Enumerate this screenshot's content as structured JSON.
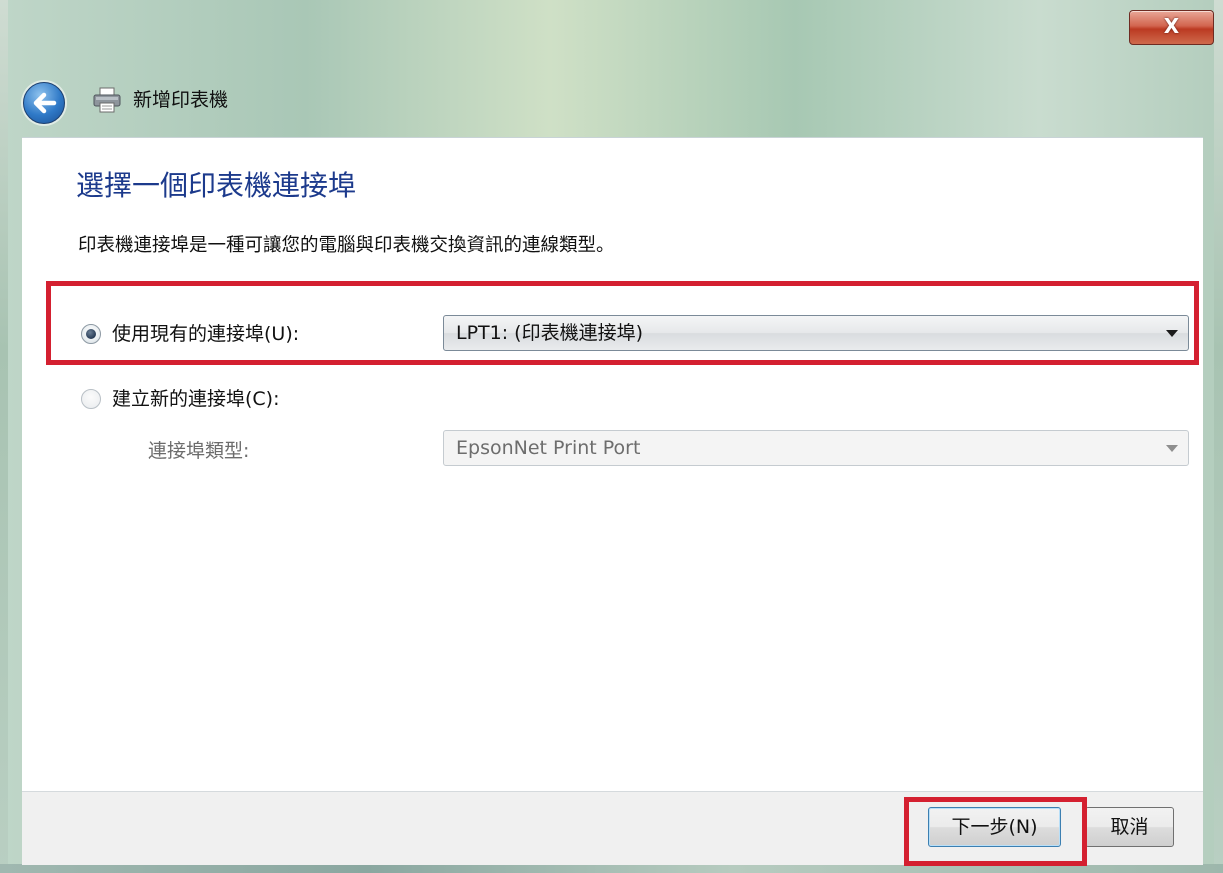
{
  "window": {
    "title": "新增印表機",
    "close_label": "X",
    "colors": {
      "heading": "#1c3a8c",
      "highlight": "#d42030",
      "close": "#c4452c"
    }
  },
  "page": {
    "heading": "選擇一個印表機連接埠",
    "description": "印表機連接埠是一種可讓您的電腦與印表機交換資訊的連線類型。"
  },
  "options": {
    "existing": {
      "label": "使用現有的連接埠(U):",
      "selected": true,
      "select_value": "LPT1: (印表機連接埠)"
    },
    "create_new": {
      "label": "建立新的連接埠(C):",
      "selected": false,
      "type_label": "連接埠類型:",
      "type_value": "EpsonNet Print Port"
    }
  },
  "buttons": {
    "next": "下一步(N)",
    "cancel": "取消"
  },
  "icons": {
    "back": "back-arrow-icon",
    "printer": "printer-icon",
    "dropdown": "chevron-down-icon"
  }
}
